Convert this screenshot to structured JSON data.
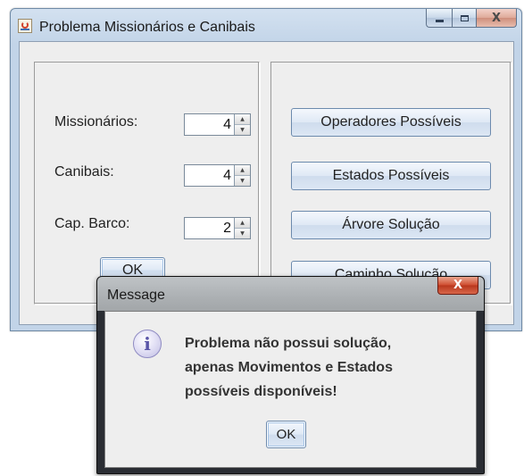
{
  "main_window": {
    "title": "Problema Missionários e Canibais",
    "controls": {
      "minimize_icon": "minimize-icon",
      "maximize_icon": "maximize-icon",
      "close_glyph": "X"
    },
    "fields": [
      {
        "label": "Missionários:",
        "value": "4"
      },
      {
        "label": "Canibais:",
        "value": "4"
      },
      {
        "label": "Cap. Barco:",
        "value": "2"
      }
    ],
    "ok_label": "OK",
    "buttons": [
      {
        "label": "Operadores Possíveis"
      },
      {
        "label": "Estados Possíveis"
      },
      {
        "label": "Árvore Solução"
      },
      {
        "label": "Caminho Solução"
      }
    ]
  },
  "dialog": {
    "title": "Message",
    "close_glyph": "X",
    "icon": "info-icon",
    "icon_glyph": "i",
    "message_lines": [
      "Problema não possui solução,",
      "apenas Movimentos e Estados",
      "possíveis disponíveis!"
    ],
    "ok_label": "OK"
  },
  "colors": {
    "window_frame": "#c2d4e8",
    "client_background": "#eeeeee",
    "button_border": "#6c8aad",
    "dialog_frame": "#2a2d33",
    "close_button": "#cf4b2e",
    "info_icon": "#5a55a8"
  }
}
